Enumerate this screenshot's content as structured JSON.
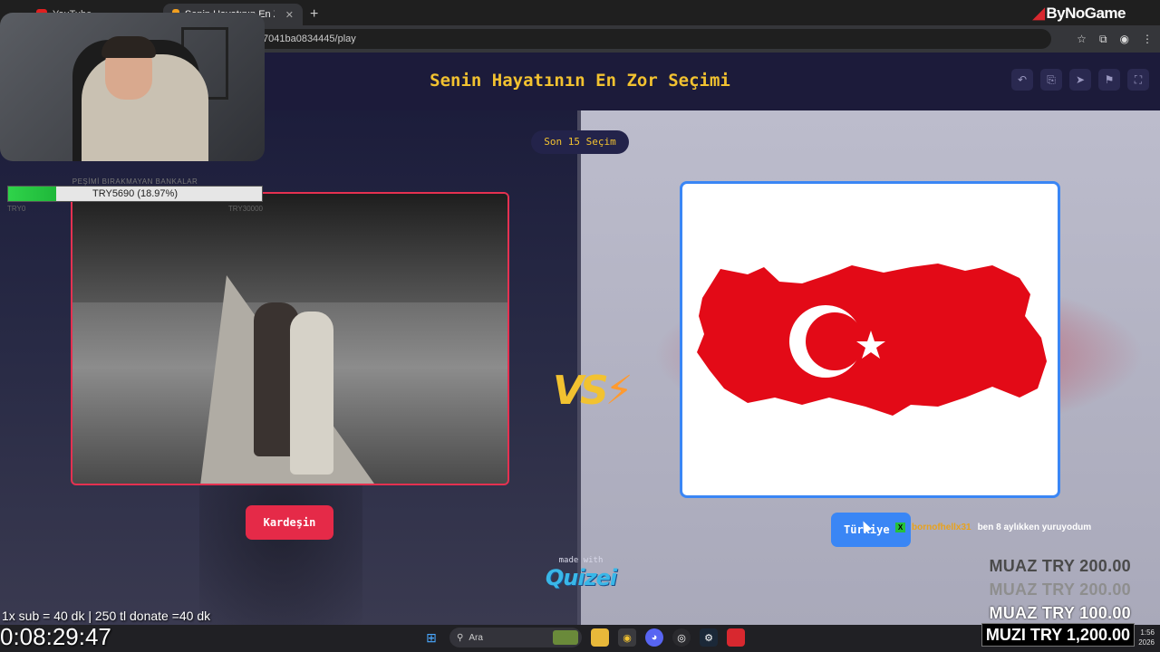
{
  "browser": {
    "tabs": [
      {
        "label": "YouTube"
      },
      {
        "label": "Senin Hayatının En Zor Seçimi"
      }
    ],
    "new_tab_symbol": "+",
    "url": "7041ba0834445/play"
  },
  "quiz": {
    "title": "Senin Hayatının En Zor Seçimi",
    "header_buttons": [
      "undo-icon",
      "share-icon",
      "send-icon",
      "flag-icon",
      "fullscreen-icon"
    ],
    "son_pill": "Son 15 Seçim",
    "vs": "VS",
    "left_choice": {
      "label": "Kardeşin"
    },
    "right_choice": {
      "label": "Türkiye"
    },
    "made_with": "made with",
    "brand": "Quizei"
  },
  "overlay": {
    "logo": "ByNoGame",
    "progress": {
      "caption": "PEŞİMİ BIRAKMAYAN BANKALAR",
      "text": "TRY5690 (18.97%)",
      "fraction": 0.1897,
      "start_label": "TRY0",
      "end_label": "TRY30000"
    },
    "chat": {
      "badge": "X",
      "user": "bornofhellx31",
      "message": "ben 8 aylıkken yuruyodum"
    },
    "donations": [
      {
        "text": "MUAZ  TRY 200.00"
      },
      {
        "text": "MUAZ  TRY 200.00"
      },
      {
        "text": "MUAZ  TRY 100.00"
      }
    ],
    "highlight_donation": "MUZI  TRY 1,200.00",
    "sub_rules": "1x sub = 40 dk | 250 tl donate =40 dk",
    "timer": "0:08:29:47"
  },
  "taskbar": {
    "search_placeholder": "Ara",
    "clock_time": "1:56",
    "clock_year": "2026"
  },
  "colors": {
    "accent_yellow": "#f2c230",
    "left_red": "#e52a48",
    "right_blue": "#3a86f5",
    "header_bg": "#1c1b3a"
  }
}
